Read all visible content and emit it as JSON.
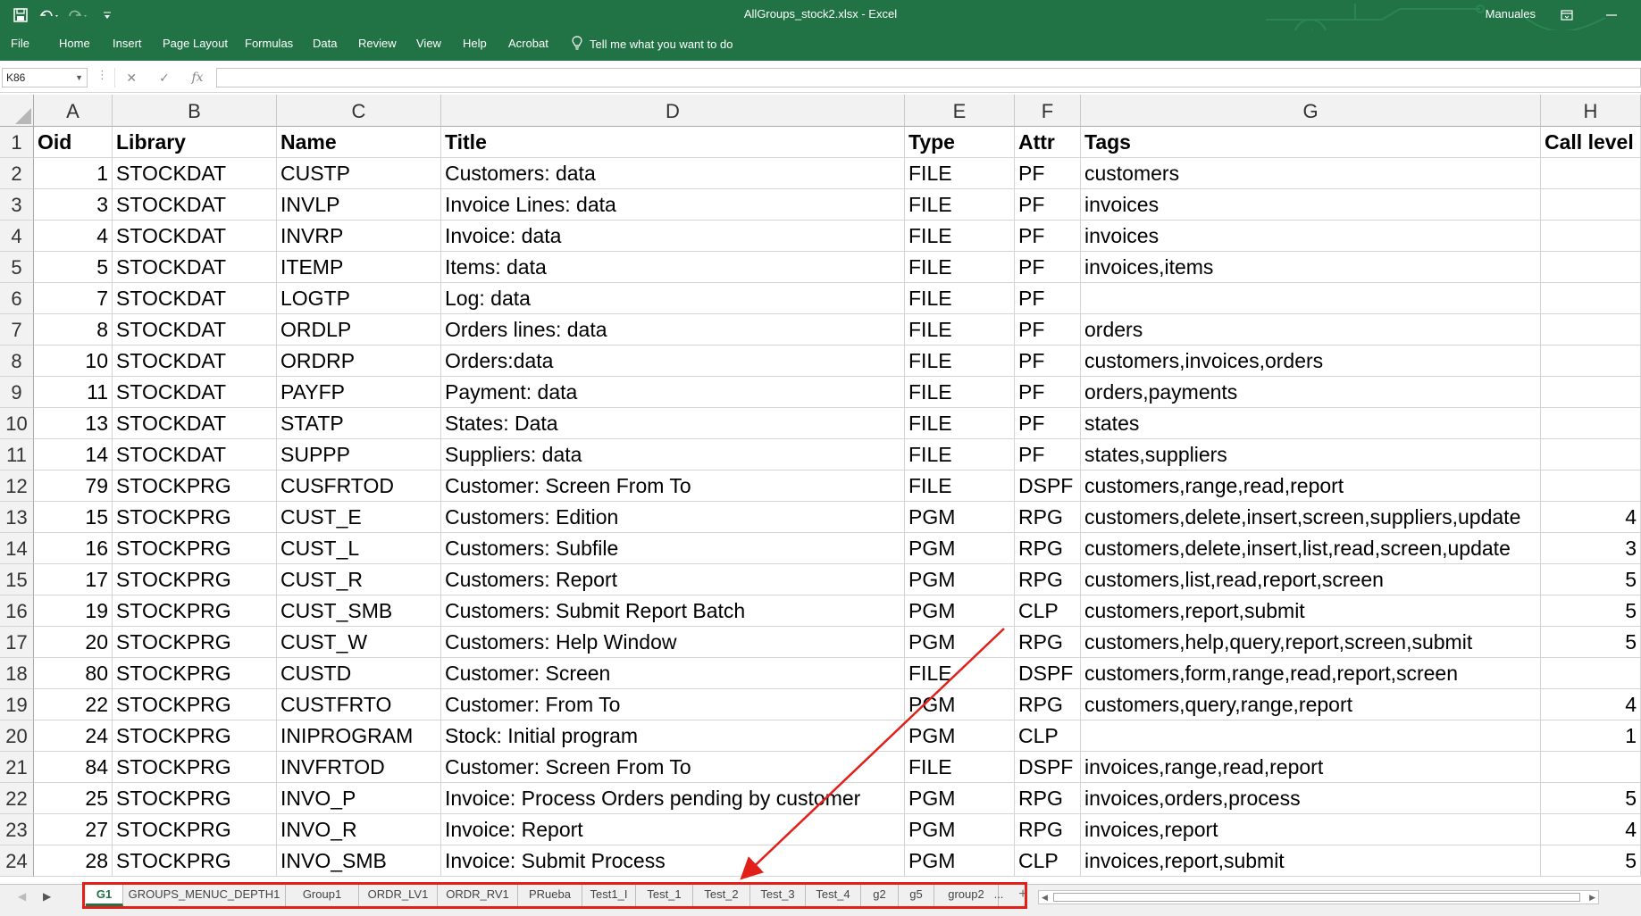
{
  "window": {
    "title": "AllGroups_stock2.xlsx  -  Excel",
    "user": "Manuales",
    "accent": "#217346",
    "annotation_color": "#e2201a"
  },
  "quick_access": {
    "save_icon": "save-icon",
    "undo_icon": "undo-icon",
    "redo_icon": "redo-icon",
    "customize_icon": "customize-icon"
  },
  "ribbon": {
    "tabs": [
      "File",
      "Home",
      "Insert",
      "Page Layout",
      "Formulas",
      "Data",
      "Review",
      "View",
      "Help",
      "Acrobat"
    ],
    "tell_me": "Tell me what you want to do"
  },
  "formula_bar": {
    "name_box": "K86",
    "formula": ""
  },
  "columns": [
    "A",
    "B",
    "C",
    "D",
    "E",
    "F",
    "G",
    "H"
  ],
  "header_row": [
    "Oid",
    "Library",
    "Name",
    "Title",
    "Type",
    "Attr",
    "Tags",
    "Call level"
  ],
  "rows": [
    [
      "1",
      "STOCKDAT",
      "CUSTP",
      "Customers: data",
      "FILE",
      "PF",
      "customers",
      ""
    ],
    [
      "3",
      "STOCKDAT",
      "INVLP",
      "Invoice Lines: data",
      "FILE",
      "PF",
      "invoices",
      ""
    ],
    [
      "4",
      "STOCKDAT",
      "INVRP",
      "Invoice: data",
      "FILE",
      "PF",
      "invoices",
      ""
    ],
    [
      "5",
      "STOCKDAT",
      "ITEMP",
      "Items:   data",
      "FILE",
      "PF",
      "invoices,items",
      ""
    ],
    [
      "7",
      "STOCKDAT",
      "LOGTP",
      "Log: data",
      "FILE",
      "PF",
      "",
      ""
    ],
    [
      "8",
      "STOCKDAT",
      "ORDLP",
      "Orders lines: data",
      "FILE",
      "PF",
      "orders",
      ""
    ],
    [
      "10",
      "STOCKDAT",
      "ORDRP",
      "Orders:data",
      "FILE",
      "PF",
      "customers,invoices,orders",
      ""
    ],
    [
      "11",
      "STOCKDAT",
      "PAYFP",
      "Payment: data",
      "FILE",
      "PF",
      "orders,payments",
      ""
    ],
    [
      "13",
      "STOCKDAT",
      "STATP",
      "States: Data",
      "FILE",
      "PF",
      "states",
      ""
    ],
    [
      "14",
      "STOCKDAT",
      "SUPPP",
      "Suppliers: data",
      "FILE",
      "PF",
      "states,suppliers",
      ""
    ],
    [
      "79",
      "STOCKPRG",
      "CUSFRTOD",
      "Customer: Screen From To",
      "FILE",
      "DSPF",
      "customers,range,read,report",
      ""
    ],
    [
      "15",
      "STOCKPRG",
      "CUST_E",
      "Customers: Edition",
      "PGM",
      "RPG",
      "customers,delete,insert,screen,suppliers,update",
      "4"
    ],
    [
      "16",
      "STOCKPRG",
      "CUST_L",
      "Customers: Subfile",
      "PGM",
      "RPG",
      "customers,delete,insert,list,read,screen,update",
      "3"
    ],
    [
      "17",
      "STOCKPRG",
      "CUST_R",
      "Customers: Report",
      "PGM",
      "RPG",
      "customers,list,read,report,screen",
      "5"
    ],
    [
      "19",
      "STOCKPRG",
      "CUST_SMB",
      "Customers: Submit Report Batch",
      "PGM",
      "CLP",
      "customers,report,submit",
      "5"
    ],
    [
      "20",
      "STOCKPRG",
      "CUST_W",
      "Customers: Help Window",
      "PGM",
      "RPG",
      "customers,help,query,report,screen,submit",
      "5"
    ],
    [
      "80",
      "STOCKPRG",
      "CUSTD",
      "Customer: Screen",
      "FILE",
      "DSPF",
      "customers,form,range,read,report,screen",
      ""
    ],
    [
      "22",
      "STOCKPRG",
      "CUSTFRTO",
      "Customer: From To",
      "PGM",
      "RPG",
      "customers,query,range,report",
      "4"
    ],
    [
      "24",
      "STOCKPRG",
      "INIPROGRAM",
      "Stock: Initial program",
      "PGM",
      "CLP",
      "",
      "1"
    ],
    [
      "84",
      "STOCKPRG",
      "INVFRTOD",
      "Customer: Screen From To",
      "FILE",
      "DSPF",
      "invoices,range,read,report",
      ""
    ],
    [
      "25",
      "STOCKPRG",
      "INVO_P",
      "Invoice: Process Orders pending by customer",
      "PGM",
      "RPG",
      "invoices,orders,process",
      "5"
    ],
    [
      "27",
      "STOCKPRG",
      "INVO_R",
      "Invoice: Report",
      "PGM",
      "RPG",
      "invoices,report",
      "4"
    ],
    [
      "28",
      "STOCKPRG",
      "INVO_SMB",
      "Invoice: Submit Process",
      "PGM",
      "CLP",
      "invoices,report,submit",
      "5"
    ]
  ],
  "sheet_tabs": [
    "G1",
    "GROUPS_MENUC_DEPTH1",
    "Group1",
    "ORDR_LV1",
    "ORDR_RV1",
    "PRueba",
    "Test1_I",
    "Test_1",
    "Test_2",
    "Test_3",
    "Test_4",
    "g2",
    "g5",
    "group2"
  ],
  "active_sheet": "G1",
  "more_sheets": "...",
  "add_sheet_label": "+"
}
